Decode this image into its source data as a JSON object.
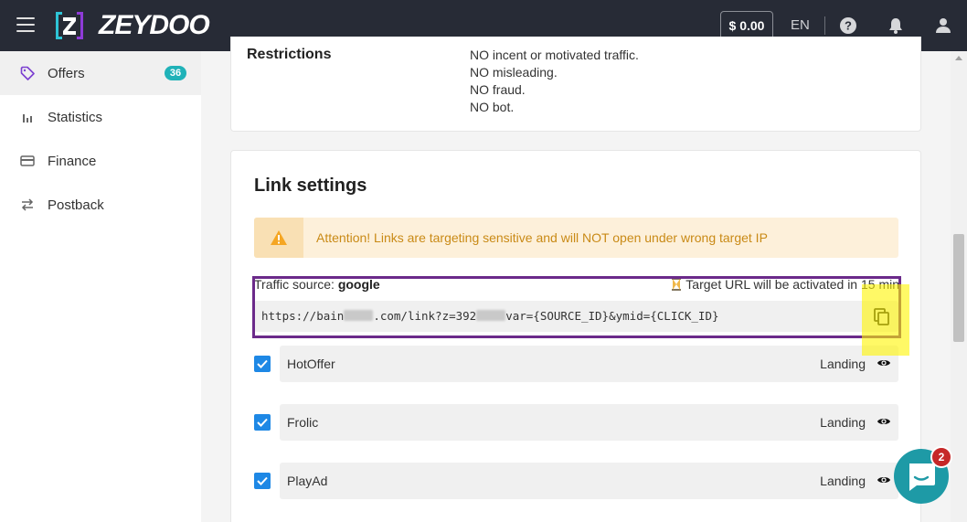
{
  "header": {
    "logo_text": "ZEYDOO",
    "balance": "$ 0.00",
    "language": "EN"
  },
  "sidebar": {
    "items": [
      {
        "label": "Offers",
        "badge": "36"
      },
      {
        "label": "Statistics"
      },
      {
        "label": "Finance"
      },
      {
        "label": "Postback"
      }
    ]
  },
  "restrictions": {
    "label": "Restrictions",
    "lines": [
      "NO incent or motivated traffic.",
      "NO misleading.",
      "NO fraud.",
      "NO bot."
    ]
  },
  "link_settings": {
    "title": "Link settings",
    "alert": {
      "strong": "Attention!",
      "text": " Links are targeting sensitive and will NOT open under wrong target IP"
    },
    "traffic_source_label": "Traffic source: ",
    "traffic_source_value": "google",
    "activation_note": "Target URL will be activated in 15 min",
    "url_part1": "https://bain",
    "url_part2": ".com/link?z=392",
    "url_part3": "var={SOURCE_ID}&ymid={CLICK_ID}",
    "landings": [
      {
        "name": "HotOffer",
        "type": "Landing"
      },
      {
        "name": "Frolic",
        "type": "Landing"
      },
      {
        "name": "PlayAd",
        "type": "Landing"
      }
    ]
  },
  "chat": {
    "unread": "2"
  },
  "colors": {
    "topbar": "#272b36",
    "accent": "#20b2b8",
    "checkbox": "#1e88e5",
    "alert_text": "#c98a16",
    "highlight_purple": "#6b2a8a",
    "highlight_yellow": "#fff500"
  }
}
